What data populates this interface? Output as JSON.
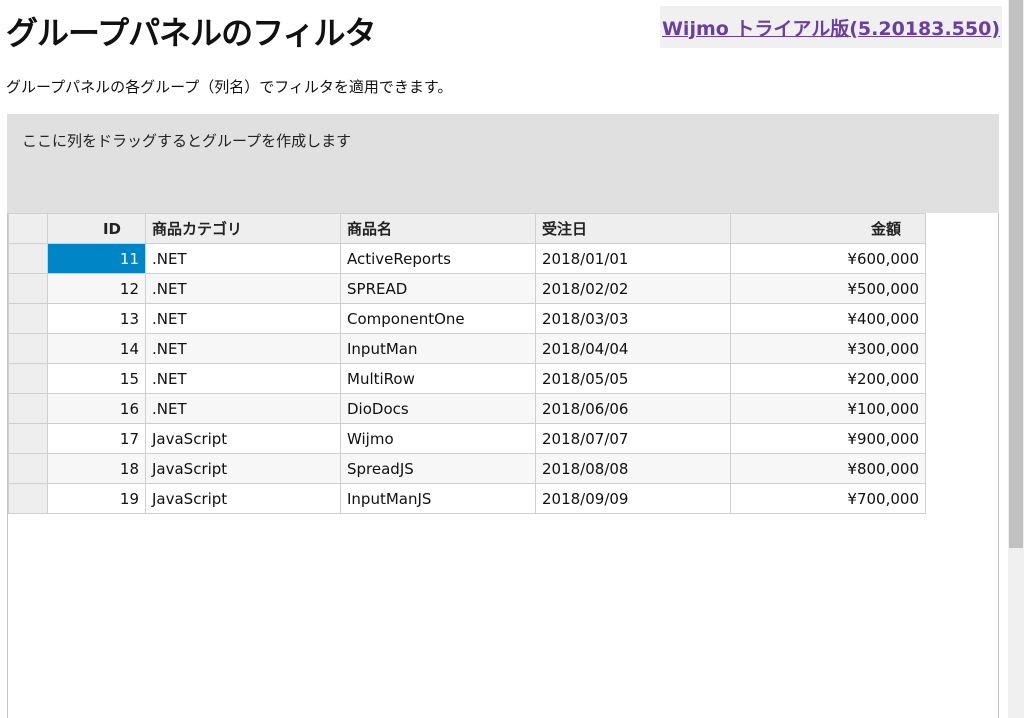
{
  "page": {
    "title": "グループパネルのフィルタ",
    "trial_link": "Wijmo トライアル版(5.20183.550)",
    "description": "グループパネルの各グループ（列名）でフィルタを適用できます。"
  },
  "group_panel": {
    "placeholder": "ここに列をドラッグするとグループを作成します"
  },
  "grid": {
    "columns": [
      "ID",
      "商品カテゴリ",
      "商品名",
      "受注日",
      "金額"
    ],
    "rows": [
      {
        "id": "11",
        "category": ".NET",
        "product": "ActiveReports",
        "date": "2018/01/01",
        "amount": "¥600,000"
      },
      {
        "id": "12",
        "category": ".NET",
        "product": "SPREAD",
        "date": "2018/02/02",
        "amount": "¥500,000"
      },
      {
        "id": "13",
        "category": ".NET",
        "product": "ComponentOne",
        "date": "2018/03/03",
        "amount": "¥400,000"
      },
      {
        "id": "14",
        "category": ".NET",
        "product": "InputMan",
        "date": "2018/04/04",
        "amount": "¥300,000"
      },
      {
        "id": "15",
        "category": ".NET",
        "product": "MultiRow",
        "date": "2018/05/05",
        "amount": "¥200,000"
      },
      {
        "id": "16",
        "category": ".NET",
        "product": "DioDocs",
        "date": "2018/06/06",
        "amount": "¥100,000"
      },
      {
        "id": "17",
        "category": "JavaScript",
        "product": "Wijmo",
        "date": "2018/07/07",
        "amount": "¥900,000"
      },
      {
        "id": "18",
        "category": "JavaScript",
        "product": "SpreadJS",
        "date": "2018/08/08",
        "amount": "¥800,000"
      },
      {
        "id": "19",
        "category": "JavaScript",
        "product": "InputManJS",
        "date": "2018/09/09",
        "amount": "¥700,000"
      }
    ]
  },
  "colors": {
    "selected_cell": "#0085c7",
    "link": "#6b3fa0",
    "group_panel_bg": "#e0e0e0"
  }
}
